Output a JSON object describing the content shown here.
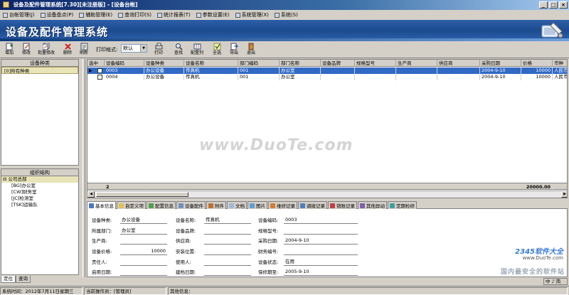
{
  "window": {
    "title": "设备及配件管理系统[7.30][未注册版] - [设备台帐]",
    "buttons": [
      "_",
      "□",
      "×"
    ]
  },
  "menu": [
    "台帐管理(J)",
    "设备盘点(P)",
    "辅助管理(E)",
    "查询打印(S)",
    "统计报表(T)",
    "参数设置(E)",
    "系统管理(X)",
    "系统(S)"
  ],
  "banner": {
    "title": "设备及配件管理系统"
  },
  "toolbar": {
    "add": "增加",
    "edit": "修改",
    "batch_edit": "批量修改",
    "delete": "删除",
    "refresh": "刷新",
    "print_format_label": "打印格式:",
    "print_format_value": "默认",
    "print": "打印",
    "find": "查找",
    "config": "配置列",
    "select_all": "全选",
    "export": "导出",
    "exit": "退出"
  },
  "left": {
    "category_header": "设备种类",
    "category_item": "[0]所有种类",
    "org_header": "组织结构",
    "org_root": "公司总部",
    "org_children": [
      "[BG]办公室",
      "[CW]财务室",
      "[JC]检测室",
      "[TSK]运输队"
    ],
    "tabs": [
      "定位",
      "查询"
    ]
  },
  "grid": {
    "columns": [
      "选中",
      "设备编码",
      "设备种类",
      "设备名称",
      "部门编码",
      "部门名称",
      "设备品牌",
      "规格型号",
      "生产商",
      "供应商",
      "采购日期",
      "价格",
      "币种"
    ],
    "rows": [
      {
        "code": "0003",
        "category": "办公设备",
        "name": "传真机",
        "dept_code": "001",
        "dept_name": "办公室",
        "brand": "",
        "model": "",
        "maker": "",
        "supplier": "",
        "date": "2004-9-10",
        "price": "10000",
        "currency": "人民币"
      },
      {
        "code": "0004",
        "category": "办公设备",
        "name": "传真机",
        "dept_code": "001",
        "dept_name": "办公室",
        "brand": "",
        "model": "",
        "maker": "",
        "supplier": "",
        "date": "2004-9-10",
        "price": "10000",
        "currency": "人民币"
      }
    ],
    "summary_count": "2",
    "summary_price": "20000.00"
  },
  "detail_tabs": [
    "基本信息",
    "自定义项",
    "配置信息",
    "设备配件",
    "附件",
    "文档",
    "图片",
    "维修记录",
    "调拨记录",
    "销账记录",
    "其他异动",
    "定期检修"
  ],
  "detail": {
    "category_label": "设备种类:",
    "category": "办公设备",
    "name_label": "设备名称:",
    "name": "传真机",
    "code_label": "设备编码:",
    "code": "0003",
    "dept_label": "所属部门:",
    "dept": "办公室",
    "brand_label": "设备品牌:",
    "brand": "",
    "model_label": "规格型号:",
    "model": "",
    "maker_label": "生产商:",
    "maker": "",
    "supplier_label": "供应商:",
    "supplier": "",
    "purchase_date_label": "采购日期:",
    "purchase_date": "2004-9-10",
    "price_label": "设备价格:",
    "price": "10000",
    "location_label": "安装位置:",
    "location": "",
    "finance_no_label": "财务编号:",
    "finance_no": "",
    "owner_label": "责任人:",
    "owner": "",
    "user_label": "使用人:",
    "user": "",
    "status_label": "设备状态:",
    "status": "在用",
    "start_date_label": "启用日期:",
    "start_date": "",
    "build_date_label": "建档日期:",
    "build_date": "",
    "warranty_label": "保修期至:",
    "warranty": "2005-9-10"
  },
  "status": {
    "time": "系统时间：2012年7月11日星期三",
    "operator": "当前操作员：[管理员]",
    "other": "其他信息："
  },
  "ime": "中 ♪ 简",
  "watermarks": {
    "center": "www.DuoTe.com",
    "brand": "2345软件大全",
    "brand_url": "www.DuoTe.com",
    "slogan": "国内最安全的软件站"
  }
}
